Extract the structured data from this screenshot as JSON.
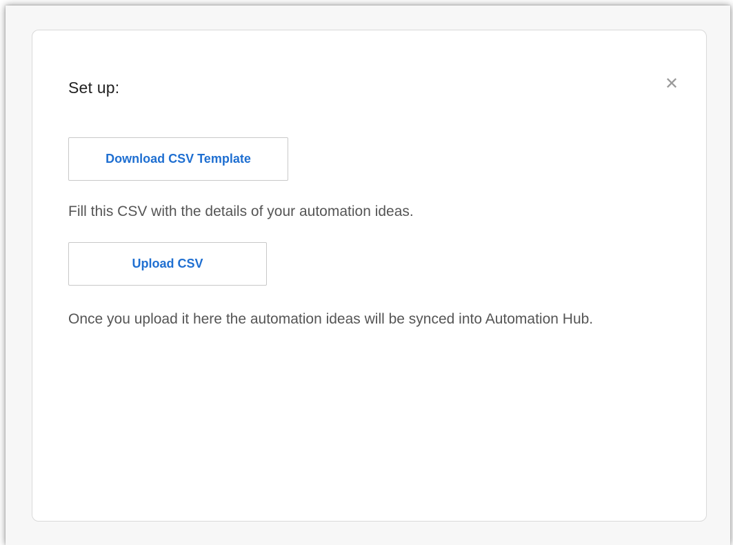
{
  "dialog": {
    "title": "Set up:",
    "close_icon": "close-icon",
    "download_button_label": "Download CSV Template",
    "fill_instruction": "Fill this CSV with the details of your automation ideas.",
    "upload_button_label": "Upload CSV",
    "sync_note": "Once you upload it here the automation ideas will be synced into Automation Hub."
  },
  "colors": {
    "button_text": "#1f6fd1",
    "body_text": "#555555",
    "title_text": "#222222",
    "border": "#d9d9d9",
    "backdrop": "#f7f7f7"
  }
}
